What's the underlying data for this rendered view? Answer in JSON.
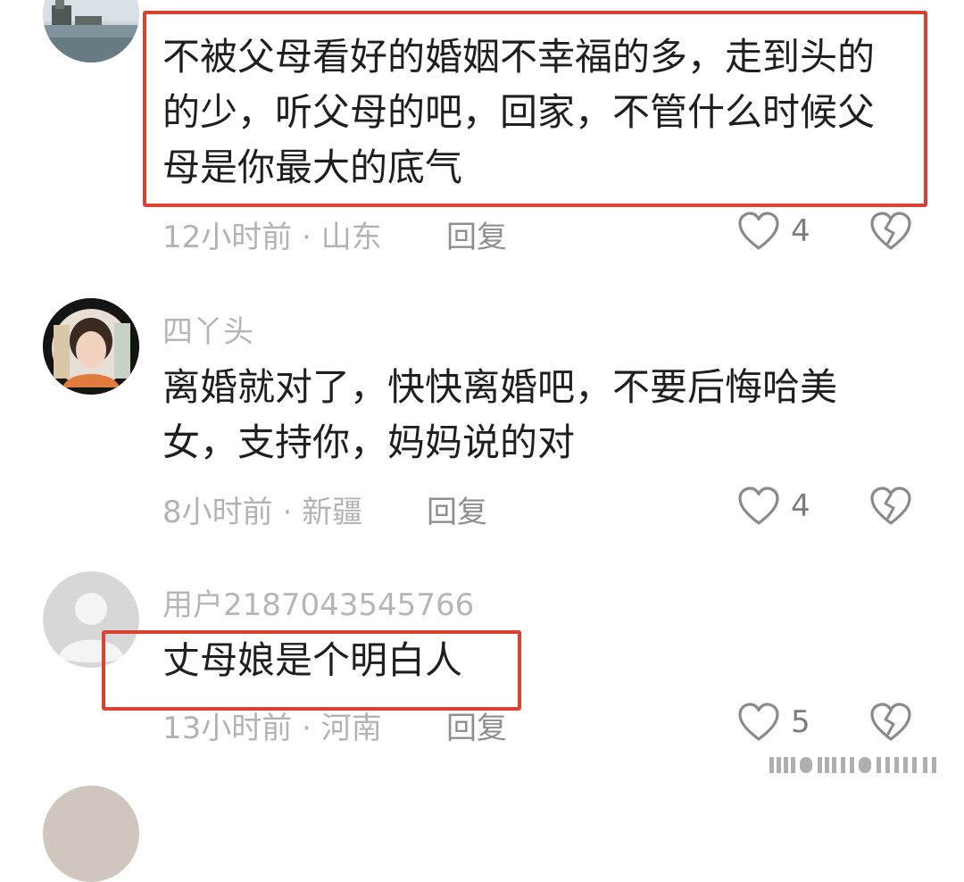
{
  "comments": [
    {
      "username": "",
      "text": "不被父母看好的婚姻不幸福的多，走到头的的少，听父母的吧，回家，不管什么时候父母是你最大的底气",
      "time": "12小时前",
      "location": "山东",
      "reply_label": "回复",
      "likes": "4"
    },
    {
      "username": "四丫头",
      "text": "离婚就对了，快快离婚吧，不要后悔哈美女，支持你，妈妈说的对",
      "time": "8小时前",
      "location": "新疆",
      "reply_label": "回复",
      "likes": "4"
    },
    {
      "username": "用户2187043545766",
      "text": "丈母娘是个明白人",
      "time": "13小时前",
      "location": "河南",
      "reply_label": "回复",
      "likes": "5"
    }
  ],
  "meta_separator": " · ",
  "colors": {
    "highlight": "#d8422e",
    "muted_text": "#b3b3b3",
    "icon": "#8a8a8a"
  },
  "icons": [
    "heart-outline-icon",
    "broken-heart-icon"
  ]
}
